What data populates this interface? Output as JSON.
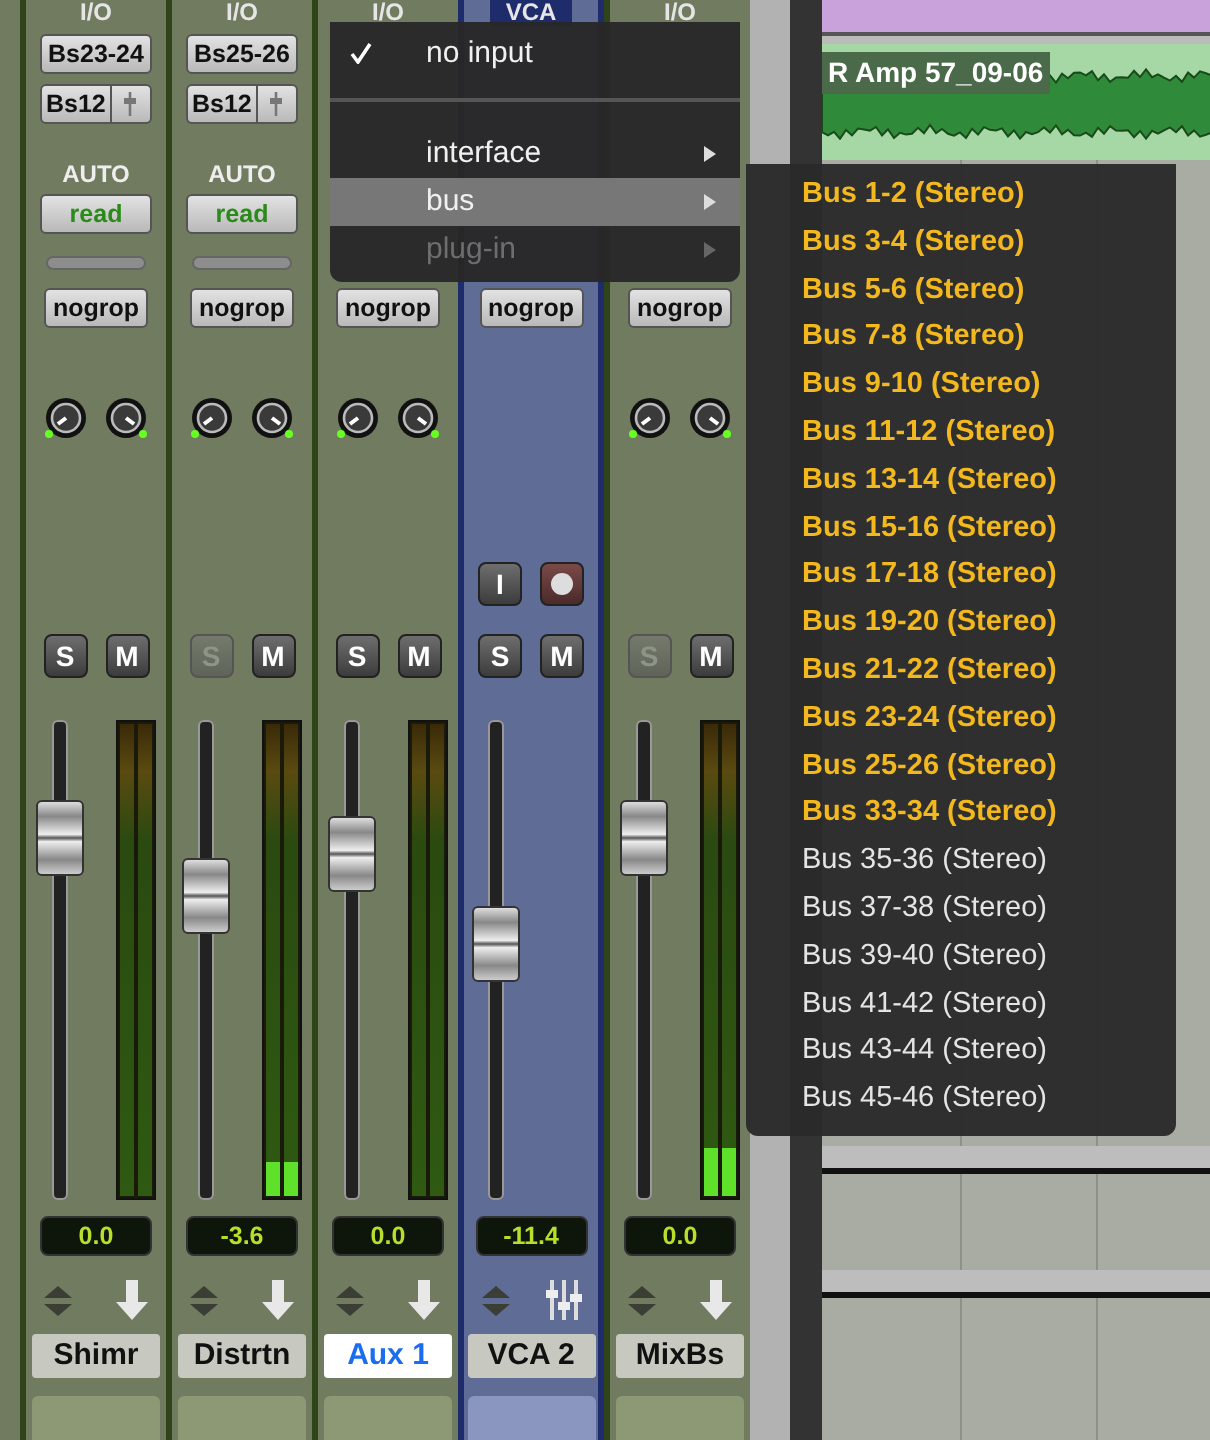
{
  "strips": [
    {
      "kind": "partial"
    },
    {
      "kind": "audio",
      "header": "I/O",
      "input": "Bs23-24",
      "output": "Bs12",
      "automation_label": "AUTO",
      "automation": "read",
      "group": "nogrop",
      "solo": "S",
      "solo_disabled": false,
      "mute": "M",
      "fader": {
        "level": 0.8
      },
      "meter": {
        "level": 0
      },
      "volume": "0.0",
      "name": "Shimr",
      "selected": false
    },
    {
      "kind": "audio",
      "header": "I/O",
      "input": "Bs25-26",
      "output": "Bs12",
      "automation_label": "AUTO",
      "automation": "read",
      "group": "nogrop",
      "solo": "S",
      "solo_disabled": true,
      "mute": "M",
      "fader": {
        "level": 0.66
      },
      "meter": {
        "level": 0.07
      },
      "volume": "-3.6",
      "name": "Distrtn",
      "selected": false
    },
    {
      "kind": "audio",
      "header": "I/O",
      "group": "nogrop",
      "solo": "S",
      "solo_disabled": false,
      "mute": "M",
      "fader": {
        "level": 0.76
      },
      "meter": {
        "level": 0
      },
      "volume": "0.0",
      "name": "Aux 1",
      "selected": true
    },
    {
      "kind": "vca",
      "header": "VCA",
      "group": "nogrop",
      "input_button": "I",
      "solo": "S",
      "solo_disabled": false,
      "mute": "M",
      "fader": {
        "level": 0.54
      },
      "volume": "-11.4",
      "name": "VCA 2",
      "selected": false
    },
    {
      "kind": "audio",
      "header": "I/O",
      "group": "nogrop",
      "solo": "S",
      "solo_disabled": true,
      "mute": "M",
      "fader": {
        "level": 0.8
      },
      "meter": {
        "level": 0.1
      },
      "volume": "0.0",
      "name": "MixBs",
      "selected": false
    }
  ],
  "edit_window": {
    "clip_name": "R Amp 57_09-06"
  },
  "input_menu": {
    "items": [
      {
        "kind": "item",
        "label": "no input",
        "checked": true,
        "selected": false,
        "disabled": false
      },
      {
        "kind": "separator"
      },
      {
        "kind": "submenu",
        "label": "interface",
        "checked": false,
        "selected": false,
        "disabled": false
      },
      {
        "kind": "submenu",
        "label": "bus",
        "checked": false,
        "selected": true,
        "disabled": false
      },
      {
        "kind": "submenu",
        "label": "plug-in",
        "checked": false,
        "selected": false,
        "disabled": true
      }
    ]
  },
  "bus_submenu": {
    "items": [
      {
        "label": "Bus 1-2 (Stereo)",
        "in_use": true
      },
      {
        "label": "Bus 3-4 (Stereo)",
        "in_use": true
      },
      {
        "label": "Bus 5-6 (Stereo)",
        "in_use": true
      },
      {
        "label": "Bus 7-8 (Stereo)",
        "in_use": true
      },
      {
        "label": "Bus 9-10 (Stereo)",
        "in_use": true
      },
      {
        "label": "Bus 11-12 (Stereo)",
        "in_use": true
      },
      {
        "label": "Bus 13-14 (Stereo)",
        "in_use": true
      },
      {
        "label": "Bus 15-16 (Stereo)",
        "in_use": true
      },
      {
        "label": "Bus 17-18 (Stereo)",
        "in_use": true
      },
      {
        "label": "Bus 19-20 (Stereo)",
        "in_use": true
      },
      {
        "label": "Bus 21-22 (Stereo)",
        "in_use": true
      },
      {
        "label": "Bus 23-24 (Stereo)",
        "in_use": true
      },
      {
        "label": "Bus 25-26 (Stereo)",
        "in_use": true
      },
      {
        "label": "Bus 33-34 (Stereo)",
        "in_use": true
      },
      {
        "label": "Bus 35-36 (Stereo)",
        "in_use": false
      },
      {
        "label": "Bus 37-38 (Stereo)",
        "in_use": false
      },
      {
        "label": "Bus 39-40 (Stereo)",
        "in_use": false
      },
      {
        "label": "Bus 41-42 (Stereo)",
        "in_use": false
      },
      {
        "label": "Bus 43-44 (Stereo)",
        "in_use": false
      },
      {
        "label": "Bus 45-46 (Stereo)",
        "in_use": false
      }
    ]
  }
}
